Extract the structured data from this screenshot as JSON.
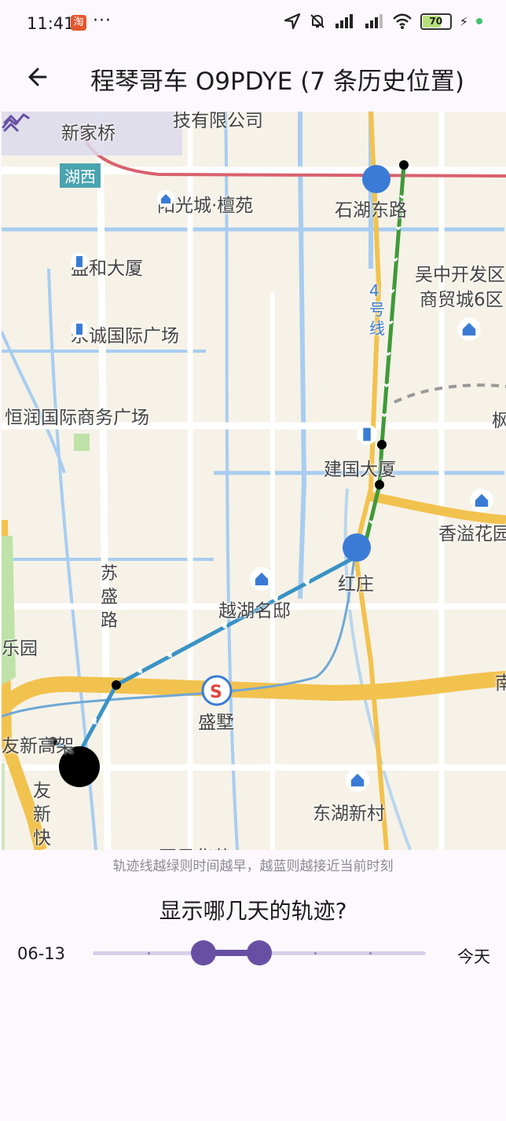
{
  "status_bar": {
    "time": "11:41",
    "dots": "···",
    "battery": "70"
  },
  "app_bar": {
    "title": "程琴哥车 O9PDYE (7 条历史位置)"
  },
  "map": {
    "labels": {
      "xinjiaqiao": "新家桥",
      "huxi": "湖西",
      "top_company": "技有限公司",
      "yangguangcheng": "阳光城·檀苑",
      "shihudonglu": "石湖东路",
      "shenghe": "盛和大厦",
      "wuzhong1": "吴中开发区",
      "wuzhong2": "商贸城6区",
      "line4": "4号线",
      "yongcheng": "永诚国际广场",
      "hengrun": "恒润国际商务广场",
      "jianguo": "建国大厦",
      "xiangyi": "香溢花园",
      "hongzhuang": "红庄",
      "susheng": "苏盛路",
      "yuehu": "越湖名邸",
      "leyuan": "乐园",
      "shengshu": "盛墅",
      "youxin": "友新高架",
      "youxinkuai": "友新快",
      "donghu": "东湖新村",
      "bottom": "园风华苑",
      "right_edge": "南",
      "right_edge2": "枫"
    },
    "track_colors": {
      "older": "#3f9a3a",
      "newer": "#3a93c4"
    },
    "current_marker": "current-position-dot"
  },
  "hint": "轨迹线越绿则时间越早，越蓝则越接近当前时刻",
  "question": "显示哪几天的轨迹?",
  "slider": {
    "start_label": "06-13",
    "end_label": "今天",
    "range": [
      0.3333,
      0.5
    ]
  }
}
